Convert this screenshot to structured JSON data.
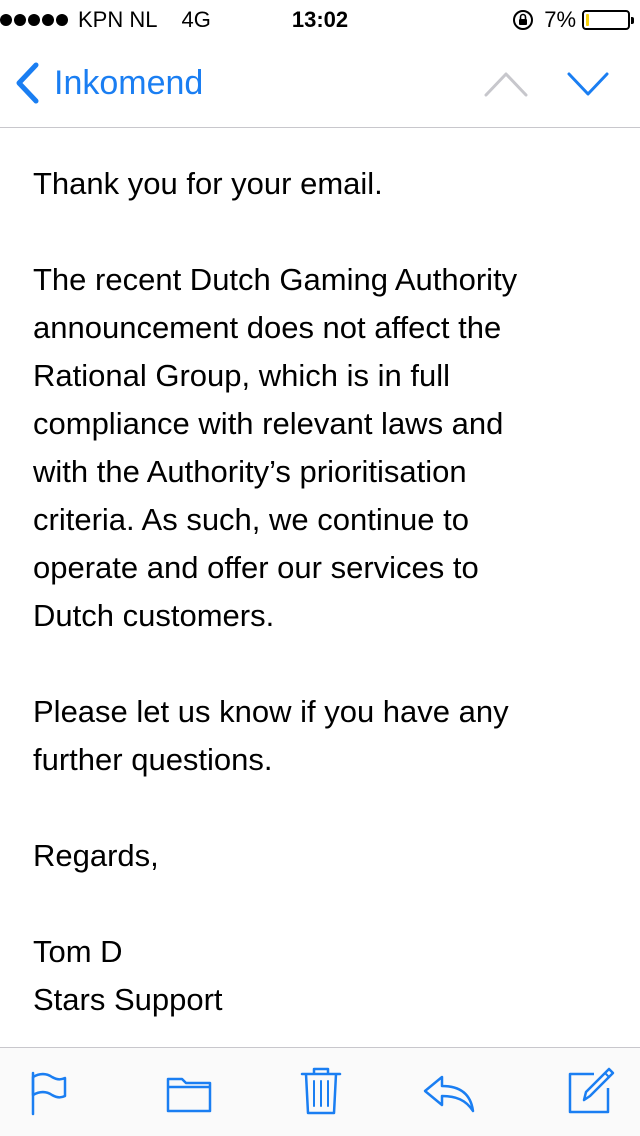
{
  "status_bar": {
    "carrier": "KPN NL",
    "network": "4G",
    "time": "13:02",
    "battery_percent": "7%",
    "battery_level": 0.07,
    "battery_color": "#f6d10e"
  },
  "nav": {
    "back_label": "Inkomend",
    "accent_color": "#1a7ef2",
    "disabled_color": "#c7c7cc",
    "prev_icon": "chevron-up-icon",
    "next_icon": "chevron-down-icon"
  },
  "email": {
    "paragraphs": [
      {
        "lines": [
          "Thank you for your email."
        ]
      },
      {
        "lines": [
          "The recent Dutch Gaming Authority",
          "announcement does not affect the",
          "Rational Group, which is in full",
          "compliance with relevant laws and",
          "with the Authority’s prioritisation",
          "criteria. As such, we continue to",
          "operate and offer our services to",
          "Dutch customers."
        ]
      },
      {
        "lines": [
          "Please let us know if you have any",
          "further questions."
        ]
      },
      {
        "lines": [
          "Regards,"
        ]
      },
      {
        "lines": [
          "Tom D",
          "Stars Support"
        ]
      }
    ]
  },
  "toolbar": {
    "items": [
      "flag-icon",
      "folder-icon",
      "trash-icon",
      "reply-icon",
      "compose-icon"
    ]
  }
}
